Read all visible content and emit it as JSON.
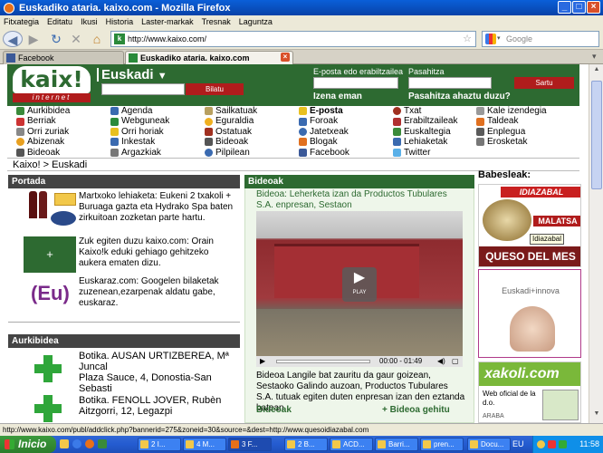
{
  "window": {
    "title": "Euskadiko ataria. kaixo.com - Mozilla Firefox"
  },
  "menu": [
    "Fitxategia",
    "Editatu",
    "Ikusi",
    "Historia",
    "Laster-markak",
    "Tresnak",
    "Laguntza"
  ],
  "nav": {
    "url": "http://www.kaixo.com/",
    "search_placeholder": "Google"
  },
  "tabs": [
    {
      "label": "Facebook",
      "active": false
    },
    {
      "label": "Euskadiko ataria. kaixo.com",
      "active": true
    }
  ],
  "header": {
    "logo_text": "kaix!",
    "logo_sub": "internet",
    "region": "Euskadi",
    "search_button": "Bilatu",
    "email_label": "E-posta edo erabiltzailea",
    "password_label": "Pasahitza",
    "login_button": "Sartu",
    "register_link": "Izena eman",
    "forgot_link": "Pasahitza ahaztu duzu?"
  },
  "links": [
    [
      "Aurkibidea",
      "Berriak",
      "Orri zuriak",
      "Abizenak",
      "Bideoak"
    ],
    [
      "Agenda",
      "Webguneak",
      "Orri horiak",
      "Inkestak",
      "Argazkiak"
    ],
    [
      "Sailkatuak",
      "Eguraldia",
      "Ostatuak",
      "Bideoak",
      "Pilpilean"
    ],
    [
      "E-posta",
      "Foroak",
      "Jatetxeak",
      "Blogak",
      "Facebook"
    ],
    [
      "Txat",
      "Erabiltzaileak",
      "Euskaltegia",
      "Lehiaketak",
      "Twitter"
    ],
    [
      "Kale izendegia",
      "Taldeak",
      "Enplegua",
      "Erosketak"
    ]
  ],
  "breadcrumb": "Kaixo! > Euskadi",
  "portada": {
    "heading": "Portada",
    "items": [
      "Martxoko lehiaketa: Eukeni 2 txakoli + Buruaga gazta eta Hydrako Spa baten zirkuitoan zozketan parte hartu.",
      "Zuk egiten duzu kaixo.com: Orain Kaixo!k eduki gehiago gehitzeko aukera ematen dizu.",
      "Euskaraz.com: Googelen bilaketak zuzenean,ezarpenak aldatu gabe, euskaraz."
    ],
    "eu_logo": "(Eu)"
  },
  "aurkibidea": {
    "heading": "Aurkibidea",
    "items": [
      {
        "title": "Botika. AUSAN URTIZBEREA, Mª Juncal",
        "address": "Plaza Sauce, 4, Donostia-San Sebasti"
      },
      {
        "title": "Botika. FENOLL JOVER, Rubèn",
        "address": "Aitzgorri, 12, Legazpi"
      }
    ]
  },
  "bideoak": {
    "heading": "Bideoak",
    "title": "Bideoa: Leherketa izan da Productos Tubulares S.A. enpresan, Sestaon",
    "play_label": "PLAY",
    "time": "00:00 - 01:49",
    "description": "Bideoa Langile bat zauritu da gaur goizean, Sestaoko Galindo auzoan, Productos Tubulares S.A. tutuak egiten duten enpresan izan den eztanda batean.",
    "footer_left": "Bideoak",
    "footer_right": "+ Bideoa gehitu"
  },
  "sponsors": {
    "heading": "Babesleak:",
    "ad1_top": "IDIAZABAL",
    "ad1_mid": "MALATSA",
    "ad1_tooltip": "Idiazabal",
    "ad1_bottom": "QUESO DEL MES",
    "ad2_text": "Euskadi+innova",
    "ad3_title": "xakoli.com",
    "ad3_text": "Web oficial de la d.o.",
    "ad3_sub": "ARABA"
  },
  "status": "http://www.kaixo.com/publ/addclick.php?bannerid=275&zoneid=30&source=&dest=http://www.quesoidiazabal.com",
  "taskbar": {
    "start": "Inicio",
    "tasks": [
      "2 I...",
      "4 M...",
      "3 F...",
      "2 B...",
      "ACD...",
      "Barri...",
      "pren...",
      "Docu..."
    ],
    "lang": "EU",
    "clock": "11:58"
  },
  "colors": {
    "green": "#2d6a31",
    "red": "#b01c1c",
    "section_dark": "#444444"
  }
}
